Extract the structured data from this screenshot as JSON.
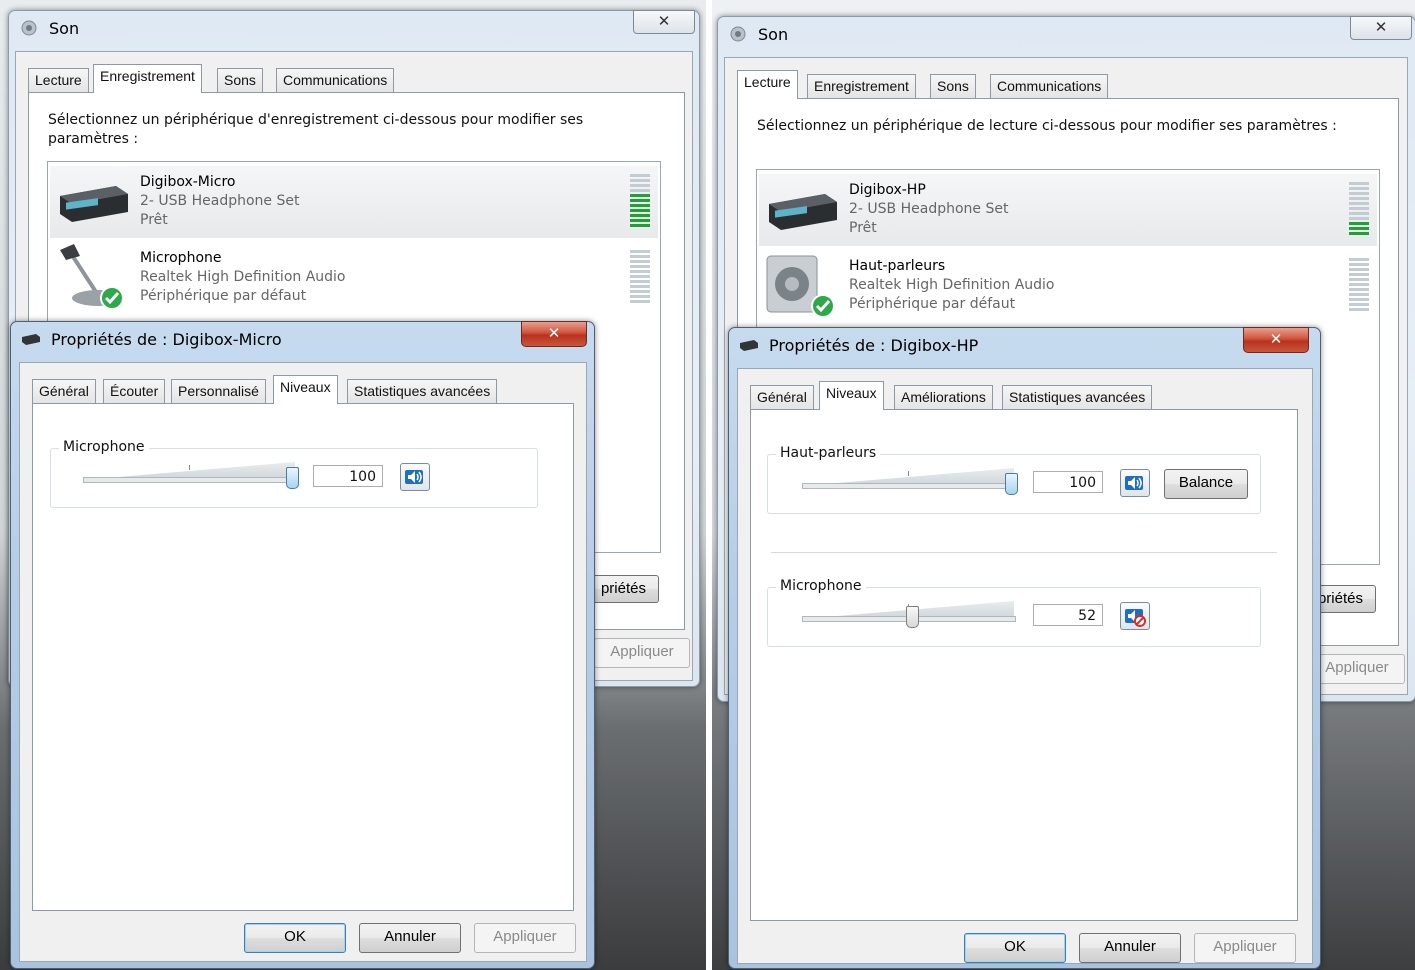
{
  "left": {
    "son": {
      "title": "Son",
      "tabs": [
        "Lecture",
        "Enregistrement",
        "Sons",
        "Communications"
      ],
      "description": "Sélectionnez un périphérique d'enregistrement ci-dessous pour modifier ses paramètres :",
      "devices": [
        {
          "name": "Digibox-Micro",
          "sub": "2- USB Headphone Set",
          "status": "Prêt",
          "level": 0.6
        },
        {
          "name": "Microphone",
          "sub": "Realtek High Definition Audio",
          "status": "Périphérique par défaut",
          "level": 0
        }
      ],
      "properties_button": "priétés",
      "apply_button": "Appliquer"
    },
    "props": {
      "title": "Propriétés de : Digibox-Micro",
      "tabs": [
        "Général",
        "Écouter",
        "Personnalisé",
        "Niveaux",
        "Statistiques avancées"
      ],
      "active_tab": "Niveaux",
      "groups": [
        {
          "label": "Microphone",
          "value": "100",
          "level": 100,
          "muted": false
        }
      ],
      "ok": "OK",
      "cancel": "Annuler",
      "apply": "Appliquer"
    }
  },
  "right": {
    "son": {
      "title": "Son",
      "tabs": [
        "Lecture",
        "Enregistrement",
        "Sons",
        "Communications"
      ],
      "description": "Sélectionnez un périphérique de lecture ci-dessous pour modifier ses paramètres :",
      "devices": [
        {
          "name": "Digibox-HP",
          "sub": "2- USB Headphone Set",
          "status": "Prêt",
          "level": 0.3
        },
        {
          "name": "Haut-parleurs",
          "sub": "Realtek High Definition Audio",
          "status": "Périphérique par défaut",
          "level": 0
        }
      ],
      "properties_button": "priétés",
      "apply_button": "Appliquer"
    },
    "props": {
      "title": "Propriétés de : Digibox-HP",
      "tabs": [
        "Général",
        "Niveaux",
        "Améliorations",
        "Statistiques avancées"
      ],
      "active_tab": "Niveaux",
      "groups": [
        {
          "label": "Haut-parleurs",
          "value": "100",
          "level": 100,
          "muted": false,
          "balance": "Balance"
        },
        {
          "label": "Microphone",
          "value": "52",
          "level": 52,
          "muted": true
        }
      ],
      "ok": "OK",
      "cancel": "Annuler",
      "apply": "Appliquer"
    }
  },
  "colors": {
    "meter_on": "#21a035",
    "selection": "#e7e9eb",
    "close_red": "#c9563b"
  }
}
